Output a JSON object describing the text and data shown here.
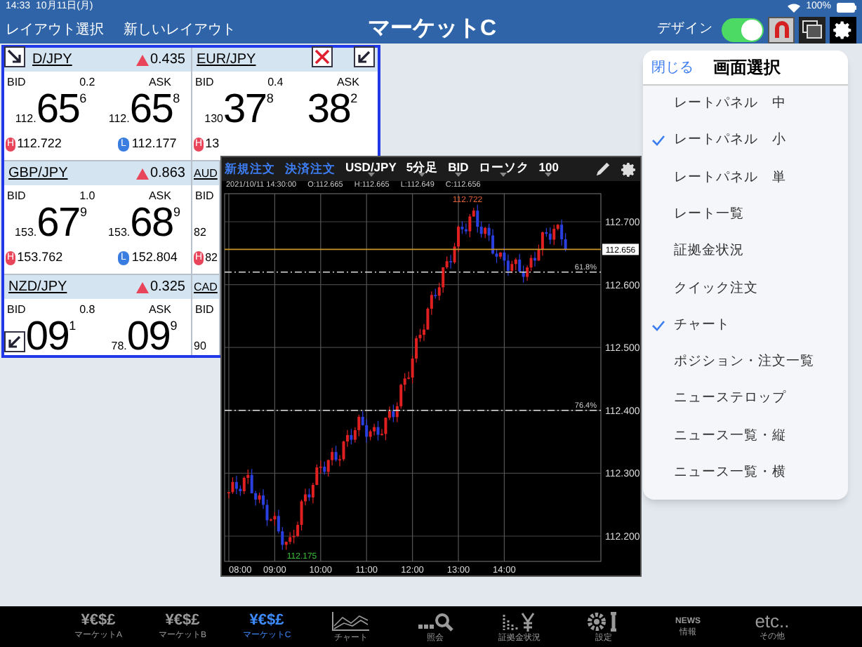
{
  "status_bar": {
    "time": "14:33",
    "date": "10月11日(月)",
    "battery": "100%"
  },
  "header": {
    "left_buttons": [
      "レイアウト選択",
      "新しいレイアウト"
    ],
    "title": "マーケットC",
    "design_label": "デザイン",
    "design_on": true,
    "tools": [
      {
        "kind": "magnet"
      },
      {
        "kind": "layout"
      },
      {
        "kind": "gear"
      }
    ]
  },
  "rate_panel": {
    "cells": [
      {
        "pair": "D/JPY",
        "change": "0.435",
        "rising": true,
        "bid_label": "BID",
        "spread": "0.2",
        "ask_label": "ASK",
        "bid": {
          "prefix": "112.",
          "big": "65",
          "small": "6"
        },
        "ask": {
          "prefix": "112.",
          "big": "65",
          "small": "8"
        },
        "high_badge": "H",
        "high": "112.722",
        "low_badge": "L",
        "low": "112.177"
      },
      {
        "pair": "EUR/JPY",
        "bid_label": "BID",
        "spread": "0.4",
        "ask_label": "ASK",
        "bid": {
          "prefix": "130",
          "big": "37",
          "small": "8"
        },
        "ask": {
          "big": "38",
          "small": "2"
        },
        "high_badge": "H",
        "high": "13"
      },
      {
        "pair": "GBP/JPY",
        "change": "0.863",
        "rising": true,
        "bid_label": "BID",
        "spread": "1.0",
        "ask_label": "ASK",
        "bid": {
          "prefix": "153.",
          "big": "67",
          "small": "9"
        },
        "ask": {
          "prefix": "153.",
          "big": "68",
          "small": "9"
        },
        "high_badge": "H",
        "high": "153.762",
        "low_badge": "L",
        "low": "152.804"
      },
      {
        "pair": "AUD",
        "bid_label": "BID",
        "bid": {
          "prefix": "82"
        },
        "high_badge": "H",
        "high": "82"
      },
      {
        "pair": "NZD/JPY",
        "change": "0.325",
        "rising": true,
        "bid_label": "BID",
        "spread": "0.8",
        "ask_label": "ASK",
        "bid": {
          "big": "09",
          "small": "1"
        },
        "ask": {
          "prefix": "78.",
          "big": "09",
          "small": "9"
        }
      },
      {
        "pair": "CAD",
        "bid_label": "BID",
        "bid": {
          "prefix": "90"
        }
      }
    ]
  },
  "chart_window": {
    "order_buttons": [
      "新規注文",
      "決済注文"
    ],
    "selectors": [
      "USD/JPY",
      "5分足",
      "BID",
      "ローソク",
      "100"
    ],
    "info": [
      "2021/10/11 14:30:00",
      "O:112.665",
      "H:112.665",
      "L:112.649",
      "C:112.656"
    ],
    "y_labels": [
      "112.700",
      "112.600",
      "112.500",
      "112.400",
      "112.300",
      "112.200"
    ],
    "x_labels": [
      "08:00",
      "09:00",
      "10:00",
      "11:00",
      "12:00",
      "13:00",
      "14:00"
    ],
    "current_price": "112.656",
    "high_label": "112.722",
    "low_label": "112.175",
    "fib_lines": [
      {
        "label": "61.8%"
      },
      {
        "label": "76.4%"
      }
    ]
  },
  "menu": {
    "close": "閉じる",
    "title": "画面選択",
    "items": [
      {
        "label": "レートパネル　中",
        "checked": false
      },
      {
        "label": "レートパネル　小",
        "checked": true
      },
      {
        "label": "レートパネル　単",
        "checked": false
      },
      {
        "label": "レート一覧",
        "checked": false
      },
      {
        "label": "証拠金状況",
        "checked": false
      },
      {
        "label": "クイック注文",
        "checked": false
      },
      {
        "label": "チャート",
        "checked": true
      },
      {
        "label": "ポジション・注文一覧",
        "checked": false
      },
      {
        "label": "ニューステロップ",
        "checked": false
      },
      {
        "label": "ニュース一覧・縦",
        "checked": false
      },
      {
        "label": "ニュース一覧・横",
        "checked": false
      }
    ]
  },
  "tab_bar": [
    {
      "kind": "currency",
      "icon_text": "¥€$£",
      "label": "マーケットA",
      "selected": false
    },
    {
      "kind": "currency",
      "icon_text": "¥€$£",
      "label": "マーケットB",
      "selected": false
    },
    {
      "kind": "currency",
      "icon_text": "¥€$£",
      "label": "マーケットC",
      "selected": true
    },
    {
      "kind": "chart",
      "label": "チャート",
      "selected": false
    },
    {
      "kind": "search",
      "label": "照会",
      "selected": false
    },
    {
      "kind": "margin",
      "label": "証拠金状況",
      "selected": false
    },
    {
      "kind": "settings",
      "label": "設定",
      "selected": false
    },
    {
      "kind": "news",
      "icon_text": "NEWS",
      "label": "情報",
      "selected": false
    },
    {
      "kind": "more",
      "icon_text": "etc..",
      "label": "その他",
      "selected": false
    }
  ]
}
